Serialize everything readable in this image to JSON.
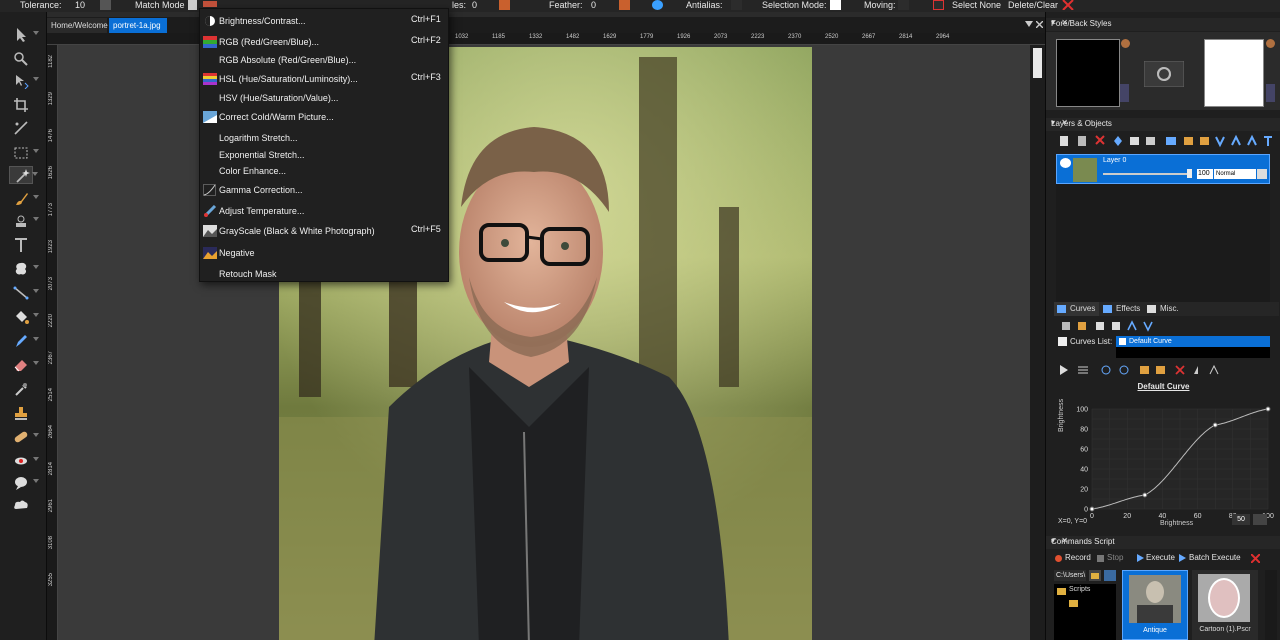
{
  "topbar": {
    "tolerance_label": "Tolerance:",
    "tolerance_value": "10",
    "match_mode_label": "Match Mode",
    "partial_label": "les:",
    "partial_value": "0",
    "feather_label": "Feather:",
    "feather_value": "0",
    "antialias_label": "Antialias:",
    "selection_mode_label": "Selection Mode:",
    "moving_label": "Moving:",
    "select_none_label": "Select None",
    "delete_clear_label": "Delete/Clear"
  },
  "doc_tabs": [
    {
      "label": "Home/Welcome",
      "active": false
    },
    {
      "label": "portret-1a.jpg",
      "active": true
    }
  ],
  "ruler_top": [
    "1032",
    "1185",
    "1332",
    "1482",
    "1629",
    "1779",
    "1926",
    "2073",
    "2223",
    "2370",
    "2520",
    "2667",
    "2814",
    "2964"
  ],
  "ruler_left": [
    "1182",
    "1329",
    "1476",
    "1626",
    "1773",
    "1923",
    "2073",
    "2220",
    "2367",
    "2514",
    "2664",
    "2814",
    "2961",
    "3108",
    "3255"
  ],
  "menu": {
    "items": [
      {
        "label": "Brightness/Contrast...",
        "shortcut": "Ctrl+F1",
        "icon": "brightness-icon"
      },
      {
        "label": "RGB (Red/Green/Blue)...",
        "shortcut": "Ctrl+F2",
        "icon": "rgb-icon"
      },
      {
        "label": "RGB Absolute (Red/Green/Blue)...",
        "shortcut": "",
        "icon": ""
      },
      {
        "label": "HSL (Hue/Saturation/Luminosity)...",
        "shortcut": "Ctrl+F3",
        "icon": "hsl-icon"
      },
      {
        "label": "HSV (Hue/Saturation/Value)...",
        "shortcut": "",
        "icon": ""
      },
      {
        "label": "Correct Cold/Warm Picture...",
        "shortcut": "",
        "icon": "cold-warm-icon"
      },
      {
        "label": "Logarithm Stretch...",
        "shortcut": "",
        "icon": ""
      },
      {
        "label": "Exponential Stretch...",
        "shortcut": "",
        "icon": ""
      },
      {
        "label": "Color Enhance...",
        "shortcut": "",
        "icon": ""
      },
      {
        "label": "Gamma Correction...",
        "shortcut": "",
        "icon": "gamma-icon"
      },
      {
        "label": "Adjust Temperature...",
        "shortcut": "",
        "icon": "thermometer-icon"
      },
      {
        "label": "GrayScale (Black & White Photograph)",
        "shortcut": "Ctrl+F5",
        "icon": "grayscale-icon"
      },
      {
        "label": "Negative",
        "shortcut": "",
        "icon": "negative-icon"
      },
      {
        "label": "Retouch Mask",
        "shortcut": "",
        "icon": ""
      }
    ]
  },
  "fore_back": {
    "title": "Fore/Back Styles",
    "fore_color": "#000000",
    "back_color": "#ffffff"
  },
  "layers": {
    "title": "Layers & Objects",
    "layer_name": "Layer 0",
    "opacity": "100",
    "blend_mode": "Normal"
  },
  "curves": {
    "tabs": [
      "Curves",
      "Effects",
      "Misc."
    ],
    "list_label": "Curves List:",
    "list_item": "Default Curve",
    "curve_title": "Default Curve",
    "y_label": "Brightness",
    "x_label": "Brightness",
    "y_ticks": [
      "100",
      "80",
      "60",
      "40",
      "20",
      "0"
    ],
    "x_ticks": [
      "0",
      "20",
      "40",
      "60",
      "80",
      "100"
    ],
    "coords": "X=0, Y=0",
    "value": "50",
    "curve_points": [
      [
        0,
        0
      ],
      [
        30,
        14
      ],
      [
        70,
        84
      ],
      [
        100,
        100
      ]
    ]
  },
  "commands": {
    "title": "Commands Script",
    "record_label": "Record",
    "stop_label": "Stop",
    "execute_label": "Execute",
    "batch_label": "Batch Execute",
    "path": "C:\\Users\\",
    "folder": "Scripts",
    "thumbs": [
      "Antique",
      "Cartoon (1).Pscr"
    ]
  },
  "colors": {
    "accent": "#0a6fd6",
    "menu_bg": "#202020",
    "panel_bg": "#1f1f1f"
  }
}
